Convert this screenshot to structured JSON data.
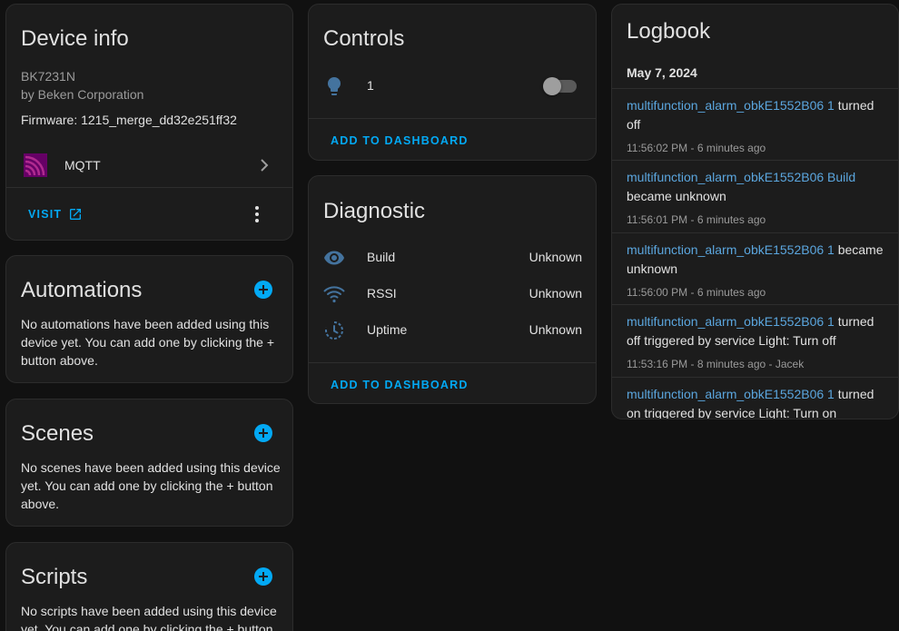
{
  "device_info": {
    "title": "Device info",
    "model": "BK7231N",
    "manufacturer": "by Beken Corporation",
    "firmware": "Firmware: 1215_merge_dd32e251ff32",
    "integration": "MQTT",
    "visit_label": "VISIT"
  },
  "automations": {
    "title": "Automations",
    "empty": "No automations have been added using this device yet. You can add one by clicking the + button above."
  },
  "scenes": {
    "title": "Scenes",
    "empty": "No scenes have been added using this device yet. You can add one by clicking the + button above."
  },
  "scripts": {
    "title": "Scripts",
    "empty": "No scripts have been added using this device yet. You can add one by clicking the + button above."
  },
  "controls": {
    "title": "Controls",
    "light_name": "1",
    "light_on": false,
    "add_label": "ADD TO DASHBOARD"
  },
  "diagnostic": {
    "title": "Diagnostic",
    "rows": [
      {
        "name": "Build",
        "state": "Unknown",
        "icon": "eye-icon"
      },
      {
        "name": "RSSI",
        "state": "Unknown",
        "icon": "wifi-icon"
      },
      {
        "name": "Uptime",
        "state": "Unknown",
        "icon": "history-clock-icon"
      }
    ],
    "add_label": "ADD TO DASHBOARD"
  },
  "logbook": {
    "title": "Logbook",
    "date": "May 7, 2024",
    "entries": [
      {
        "entity": "multifunction_alarm_obkE1552B06 1",
        "action": " turned off",
        "time": "11:56:02 PM - 6 minutes ago"
      },
      {
        "entity": "multifunction_alarm_obkE1552B06 Build",
        "action": " became unknown",
        "time": "11:56:01 PM - 6 minutes ago"
      },
      {
        "entity": "multifunction_alarm_obkE1552B06 1",
        "action": " became unknown",
        "time": "11:56:00 PM - 6 minutes ago"
      },
      {
        "entity": "multifunction_alarm_obkE1552B06 1",
        "action": " turned off triggered by service Light: Turn off",
        "time": "11:53:16 PM - 8 minutes ago - Jacek"
      },
      {
        "entity": "multifunction_alarm_obkE1552B06 1",
        "action": " turned on triggered by service Light: Turn on",
        "time": ""
      }
    ]
  },
  "colors": {
    "accent": "#03a9f4",
    "mqtt_brand": "#660066",
    "link": "#5ba6de"
  }
}
